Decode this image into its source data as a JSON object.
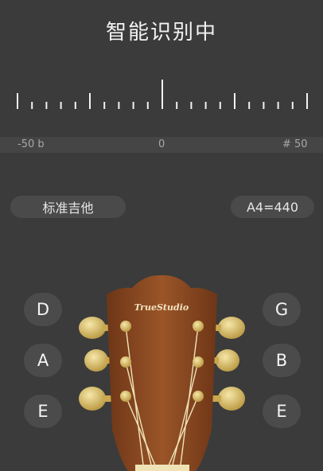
{
  "header": {
    "title": "智能识别中"
  },
  "scale": {
    "min_label": "-50 b",
    "center_label": "0",
    "max_label": "# 50",
    "tick_count": 21
  },
  "controls": {
    "tuning_label": "标准吉他",
    "reference_label": "A4=440"
  },
  "strings": {
    "left": [
      {
        "note": "D"
      },
      {
        "note": "A"
      },
      {
        "note": "E"
      }
    ],
    "right": [
      {
        "note": "G"
      },
      {
        "note": "B"
      },
      {
        "note": "E"
      }
    ]
  },
  "brand": {
    "logo_text": "TrueStudio"
  },
  "colors": {
    "background": "#3b3b3b",
    "wood": "#8a4a22",
    "peg": "#d9c06a",
    "button": "#4b4b4b"
  }
}
